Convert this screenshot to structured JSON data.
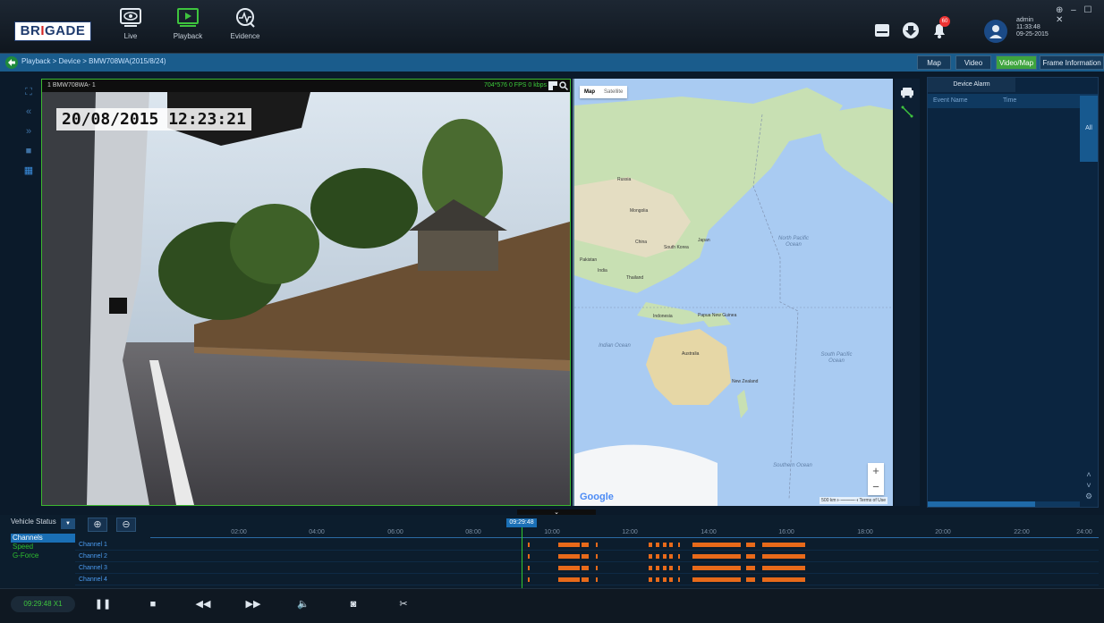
{
  "brand": {
    "prefix": "BR",
    "hi": "I",
    "suffix": "GADE"
  },
  "nav": [
    {
      "id": "live",
      "label": "Live",
      "icon": "eye-icon"
    },
    {
      "id": "playback",
      "label": "Playback",
      "icon": "playback-icon"
    },
    {
      "id": "evidence",
      "label": "Evidence",
      "icon": "evidence-icon"
    }
  ],
  "notifications": {
    "badge": "60"
  },
  "user": {
    "name": "admin",
    "time": "11:33:48",
    "date": "09-25-2015"
  },
  "window_controls": "⊕ – ☐ ✕",
  "breadcrumb": "Playback > Device > BMW708WA(2015/8/24)",
  "view_tabs": [
    "Map",
    "Video",
    "Video/Map",
    "Frame Information"
  ],
  "active_view": "Video/Map",
  "video": {
    "channel_title": "1 BMW708WA- 1",
    "stats": "704*576   0 FPS   0 kbps",
    "osd_timestamp": "20/08/2015 12:23:21"
  },
  "map": {
    "type_options": [
      "Map",
      "Satellite"
    ],
    "labels": [
      "Russia",
      "Mongolia",
      "China",
      "South Korea",
      "Japan",
      "Thailand",
      "India",
      "Pakistan",
      "Indonesia",
      "Papua New Guinea",
      "Australia",
      "New Zealand"
    ],
    "oceans": [
      "North Pacific Ocean",
      "Indian Ocean",
      "South Pacific Ocean",
      "Southern Ocean"
    ],
    "attribution": "Google",
    "scale": "500 km ⟝━━━⟞   Terms of Use"
  },
  "alarm_panel": {
    "tab": "Device Alarm",
    "columns": [
      "Event Name",
      "Time",
      "Ev"
    ],
    "side_tab": "All"
  },
  "timeline": {
    "vehicle_status_label": "Vehicle Status",
    "status_items": [
      "Channels",
      "Speed",
      "G-Force"
    ],
    "active_status": "Channels",
    "current_time": "09:29:48",
    "ticks": [
      "02:00",
      "04:00",
      "06:00",
      "08:00",
      "10:00",
      "12:00",
      "14:00",
      "16:00",
      "18:00",
      "20:00",
      "22:00",
      "24:00"
    ],
    "channels": [
      "Channel 1",
      "Channel 2",
      "Channel 3",
      "Channel 4"
    ]
  },
  "playback": {
    "time": "09:29:48  X1",
    "controls": [
      "pause",
      "stop",
      "rewind",
      "fast-forward",
      "volume",
      "snapshot",
      "clip"
    ]
  },
  "colors": {
    "accent_green": "#3ea43e",
    "accent_blue": "#1a6fb5",
    "recording_orange": "#e86a1a",
    "cursor": "#2ec82e"
  }
}
